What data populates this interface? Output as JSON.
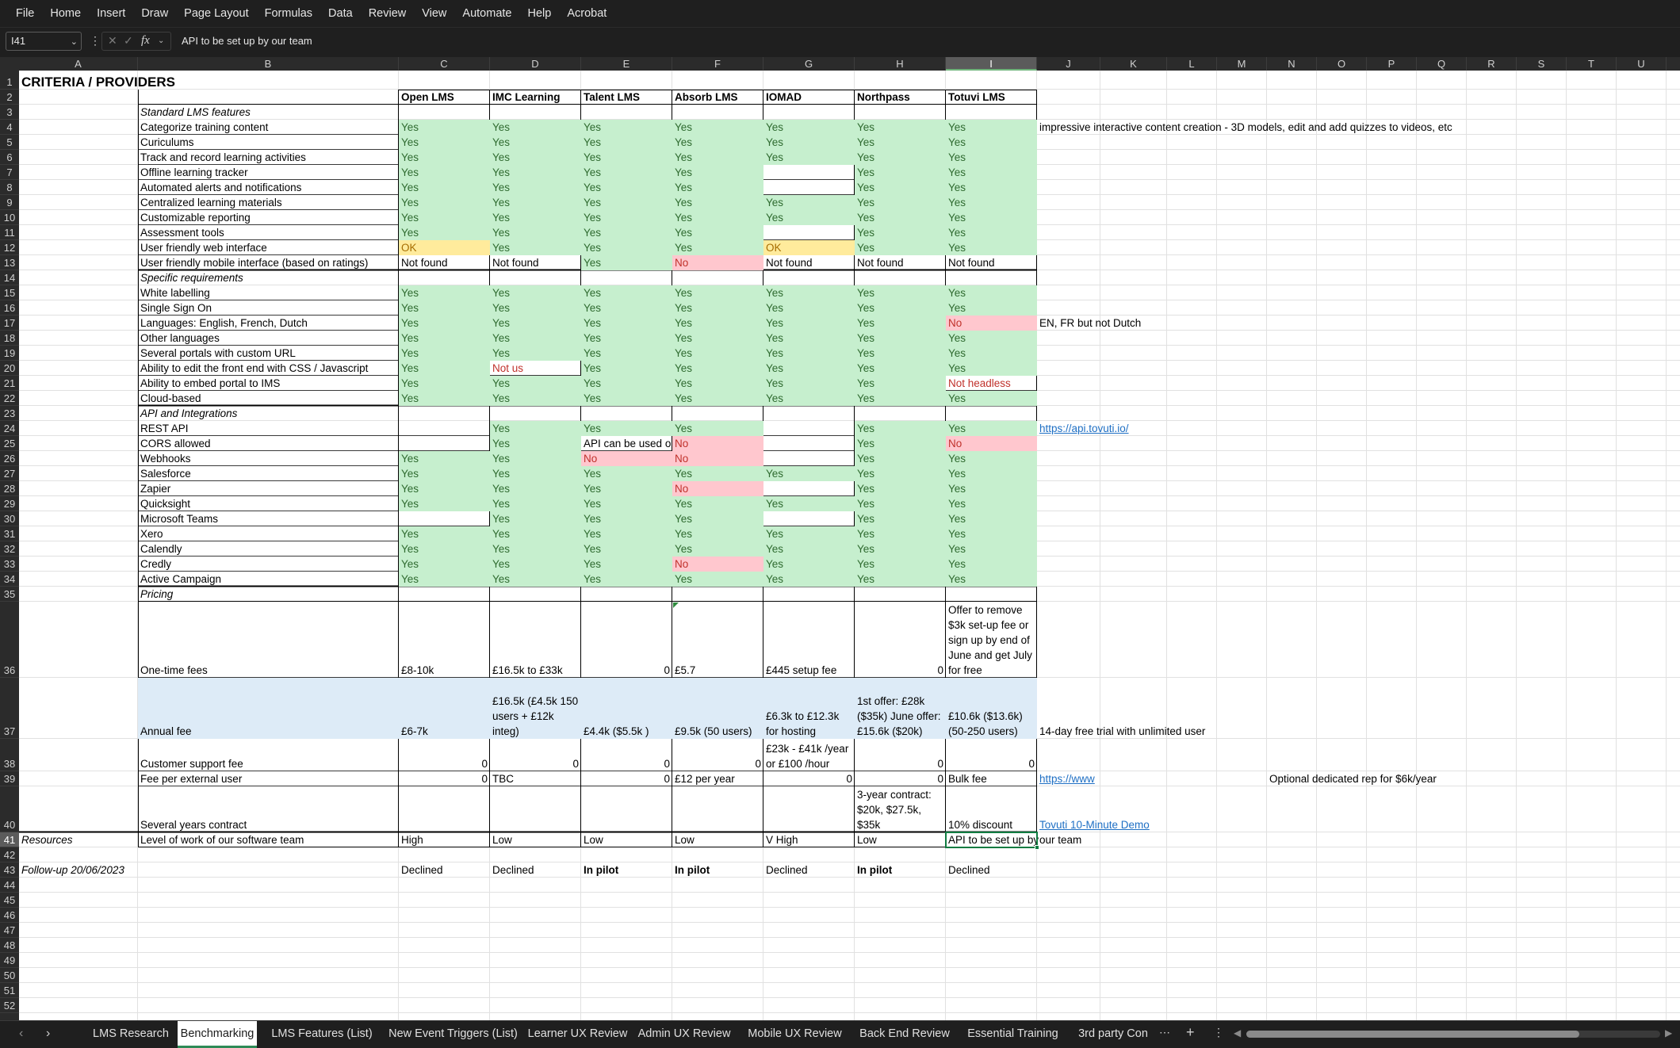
{
  "menu": [
    "File",
    "Home",
    "Insert",
    "Draw",
    "Page Layout",
    "Formulas",
    "Data",
    "Review",
    "View",
    "Automate",
    "Help",
    "Acrobat"
  ],
  "formula_bar": {
    "name_box": "I41",
    "fx": "fx",
    "content": "API to be set up by our team"
  },
  "columns": [
    "A",
    "B",
    "C",
    "D",
    "E",
    "F",
    "G",
    "H",
    "I",
    "J",
    "K",
    "L",
    "M",
    "N",
    "O",
    "P",
    "Q",
    "R",
    "S",
    "T",
    "U"
  ],
  "selected_column": "I",
  "selected_row": 41,
  "colors": {
    "green_fill": "#c6efce",
    "red_fill": "#ffc7ce",
    "amber_fill": "#ffeb9c",
    "blue_fill": "#ddebf7",
    "selection": "#107c41"
  },
  "cells": [
    {
      "r": 1,
      "c": "A",
      "v": "CRITERIA / PROVIDERS",
      "s": "title"
    },
    {
      "r": 2,
      "c": "C",
      "v": "Open LMS",
      "s": "bold"
    },
    {
      "r": 2,
      "c": "D",
      "v": "IMC Learning",
      "s": "bold"
    },
    {
      "r": 2,
      "c": "E",
      "v": "Talent LMS",
      "s": "bold"
    },
    {
      "r": 2,
      "c": "F",
      "v": "Absorb LMS",
      "s": "bold"
    },
    {
      "r": 2,
      "c": "G",
      "v": "IOMAD",
      "s": "bold"
    },
    {
      "r": 2,
      "c": "H",
      "v": "Northpass",
      "s": "bold"
    },
    {
      "r": 2,
      "c": "I",
      "v": "Totuvi LMS",
      "s": "bold"
    },
    {
      "r": 3,
      "c": "B",
      "v": "Standard LMS features",
      "s": "italic"
    },
    {
      "r": 4,
      "c": "B",
      "v": "Categorize training content"
    },
    {
      "r": 4,
      "c": "J",
      "v": "impressive interactive content creation - 3D models, edit and add quizzes to videos, etc"
    },
    {
      "r": 5,
      "c": "B",
      "v": "Curiculums"
    },
    {
      "r": 6,
      "c": "B",
      "v": "Track and record learning activities"
    },
    {
      "r": 7,
      "c": "B",
      "v": "Offline learning tracker"
    },
    {
      "r": 8,
      "c": "B",
      "v": "Automated alerts and notifications"
    },
    {
      "r": 9,
      "c": "B",
      "v": "Centralized learning materials"
    },
    {
      "r": 10,
      "c": "B",
      "v": "Customizable reporting"
    },
    {
      "r": 11,
      "c": "B",
      "v": "Assessment tools"
    },
    {
      "r": 12,
      "c": "B",
      "v": "User friendly web interface"
    },
    {
      "r": 13,
      "c": "B",
      "v": "User friendly mobile interface (based on ratings)"
    },
    {
      "r": 13,
      "c": "C",
      "v": "Not found"
    },
    {
      "r": 13,
      "c": "D",
      "v": "Not found"
    },
    {
      "r": 13,
      "c": "G",
      "v": "Not found"
    },
    {
      "r": 13,
      "c": "H",
      "v": "Not found"
    },
    {
      "r": 13,
      "c": "I",
      "v": "Not found"
    },
    {
      "r": 14,
      "c": "B",
      "v": "Specific requirements",
      "s": "italic"
    },
    {
      "r": 15,
      "c": "B",
      "v": "White labelling"
    },
    {
      "r": 16,
      "c": "B",
      "v": "Single Sign On"
    },
    {
      "r": 17,
      "c": "B",
      "v": "Languages: English, French, Dutch"
    },
    {
      "r": 17,
      "c": "J",
      "v": "EN, FR but not Dutch"
    },
    {
      "r": 18,
      "c": "B",
      "v": "Other languages"
    },
    {
      "r": 19,
      "c": "B",
      "v": "Several portals with custom URL"
    },
    {
      "r": 20,
      "c": "B",
      "v": "Ability to edit the front end with CSS / Javascript"
    },
    {
      "r": 21,
      "c": "B",
      "v": "Ability to embed portal to IMS"
    },
    {
      "r": 22,
      "c": "B",
      "v": "Cloud-based"
    },
    {
      "r": 23,
      "c": "B",
      "v": "API and Integrations",
      "s": "italic"
    },
    {
      "r": 24,
      "c": "B",
      "v": "REST API"
    },
    {
      "r": 24,
      "c": "J",
      "v": "https://api.tovuti.io/",
      "s": "link"
    },
    {
      "r": 25,
      "c": "B",
      "v": "CORS allowed"
    },
    {
      "r": 25,
      "c": "E",
      "v": "API can be used only server side",
      "s": "clip"
    },
    {
      "r": 26,
      "c": "B",
      "v": "Webhooks"
    },
    {
      "r": 27,
      "c": "B",
      "v": "Salesforce"
    },
    {
      "r": 28,
      "c": "B",
      "v": "Zapier"
    },
    {
      "r": 29,
      "c": "B",
      "v": "Quicksight"
    },
    {
      "r": 30,
      "c": "B",
      "v": "Microsoft Teams"
    },
    {
      "r": 31,
      "c": "B",
      "v": "Xero"
    },
    {
      "r": 32,
      "c": "B",
      "v": "Calendly"
    },
    {
      "r": 33,
      "c": "B",
      "v": "Credly"
    },
    {
      "r": 34,
      "c": "B",
      "v": "Active Campaign"
    },
    {
      "r": 35,
      "c": "B",
      "v": "Pricing",
      "s": "italic"
    },
    {
      "r": 36,
      "c": "B",
      "v": "One-time fees"
    },
    {
      "r": 36,
      "c": "C",
      "v": "£8-10k"
    },
    {
      "r": 36,
      "c": "D",
      "v": "£16.5k to £33k"
    },
    {
      "r": 36,
      "c": "E",
      "v": "0",
      "s": "right"
    },
    {
      "r": 36,
      "c": "F",
      "v": "£5.7"
    },
    {
      "r": 36,
      "c": "G",
      "v": "£445 setup fee"
    },
    {
      "r": 36,
      "c": "H",
      "v": "0",
      "s": "right"
    },
    {
      "r": 36,
      "c": "I",
      "v": "Offer to remove $3k set-up fee or sign up by end of June and get July for free",
      "s": "wrap"
    },
    {
      "r": 37,
      "c": "B",
      "v": "Annual fee"
    },
    {
      "r": 37,
      "c": "C",
      "v": "£6-7k"
    },
    {
      "r": 37,
      "c": "D",
      "v": "£16.5k (£4.5k 150 users + £12k integ)",
      "s": "wrap"
    },
    {
      "r": 37,
      "c": "E",
      "v": "£4.4k ($5.5k )"
    },
    {
      "r": 37,
      "c": "F",
      "v": "£9.5k (50 users)"
    },
    {
      "r": 37,
      "c": "G",
      "v": "£6.3k to £12.3k for hosting",
      "s": "wrap"
    },
    {
      "r": 37,
      "c": "H",
      "v": "1st offer: £28k ($35k) June offer: £15.6k ($20k)",
      "s": "wrap"
    },
    {
      "r": 37,
      "c": "I",
      "v": "£10.6k ($13.6k) (50-250 users)",
      "s": "wrap"
    },
    {
      "r": 37,
      "c": "J",
      "v": "14-day free trial with unlimited user"
    },
    {
      "r": 38,
      "c": "B",
      "v": "Customer support fee"
    },
    {
      "r": 38,
      "c": "C",
      "v": "0",
      "s": "right"
    },
    {
      "r": 38,
      "c": "D",
      "v": "0",
      "s": "right"
    },
    {
      "r": 38,
      "c": "E",
      "v": "0",
      "s": "right"
    },
    {
      "r": 38,
      "c": "F",
      "v": "0",
      "s": "right"
    },
    {
      "r": 38,
      "c": "G",
      "v": "£23k - £41k /year or £100 /hour",
      "s": "wrap"
    },
    {
      "r": 38,
      "c": "H",
      "v": "0",
      "s": "right"
    },
    {
      "r": 38,
      "c": "I",
      "v": "0",
      "s": "right"
    },
    {
      "r": 39,
      "c": "B",
      "v": "Fee per external user"
    },
    {
      "r": 39,
      "c": "C",
      "v": "0",
      "s": "right"
    },
    {
      "r": 39,
      "c": "D",
      "v": "TBC"
    },
    {
      "r": 39,
      "c": "E",
      "v": "0",
      "s": "right"
    },
    {
      "r": 39,
      "c": "F",
      "v": "£12 per year"
    },
    {
      "r": 39,
      "c": "G",
      "v": "0",
      "s": "right"
    },
    {
      "r": 39,
      "c": "H",
      "v": "0",
      "s": "right"
    },
    {
      "r": 39,
      "c": "I",
      "v": "Bulk fee"
    },
    {
      "r": 39,
      "c": "J",
      "v": "https://www",
      "s": "link"
    },
    {
      "r": 39,
      "c": "N",
      "v": "Optional dedicated rep for $6k/year"
    },
    {
      "r": 40,
      "c": "B",
      "v": "Several years contract"
    },
    {
      "r": 40,
      "c": "H",
      "v": "3-year contract: $20k, $27.5k, $35k",
      "s": "wrap"
    },
    {
      "r": 40,
      "c": "I",
      "v": "10% discount"
    },
    {
      "r": 40,
      "c": "J",
      "v": "Tovuti 10-Minute Demo",
      "s": "link"
    },
    {
      "r": 41,
      "c": "A",
      "v": "Resources",
      "s": "italic"
    },
    {
      "r": 41,
      "c": "B",
      "v": "Level of work of our software team"
    },
    {
      "r": 41,
      "c": "C",
      "v": "High"
    },
    {
      "r": 41,
      "c": "D",
      "v": "Low"
    },
    {
      "r": 41,
      "c": "E",
      "v": "Low"
    },
    {
      "r": 41,
      "c": "F",
      "v": "Low"
    },
    {
      "r": 41,
      "c": "G",
      "v": "V High"
    },
    {
      "r": 41,
      "c": "H",
      "v": "Low"
    },
    {
      "r": 41,
      "c": "I",
      "v": "API to be set up by"
    },
    {
      "r": 41,
      "c": "J",
      "v": "our team"
    },
    {
      "r": 43,
      "c": "A",
      "v": "Follow-up 20/06/2023",
      "s": "italic"
    },
    {
      "r": 43,
      "c": "C",
      "v": "Declined"
    },
    {
      "r": 43,
      "c": "D",
      "v": "Declined"
    },
    {
      "r": 43,
      "c": "E",
      "v": "In pilot",
      "s": "bold"
    },
    {
      "r": 43,
      "c": "F",
      "v": "In pilot",
      "s": "bold"
    },
    {
      "r": 43,
      "c": "G",
      "v": "Declined"
    },
    {
      "r": 43,
      "c": "H",
      "v": "In pilot",
      "s": "bold"
    },
    {
      "r": 43,
      "c": "I",
      "v": "Declined"
    }
  ],
  "yes_no_matrix": {
    "columns": [
      "C",
      "D",
      "E",
      "F",
      "G",
      "H",
      "I"
    ],
    "rows": {
      "4": [
        "Yes",
        "Yes",
        "Yes",
        "Yes",
        "Yes",
        "Yes",
        "Yes"
      ],
      "5": [
        "Yes",
        "Yes",
        "Yes",
        "Yes",
        "Yes",
        "Yes",
        "Yes"
      ],
      "6": [
        "Yes",
        "Yes",
        "Yes",
        "Yes",
        "Yes",
        "Yes",
        "Yes"
      ],
      "7": [
        "Yes",
        "Yes",
        "Yes",
        "Yes",
        "",
        "Yes",
        "Yes"
      ],
      "8": [
        "Yes",
        "Yes",
        "Yes",
        "Yes",
        "",
        "Yes",
        "Yes"
      ],
      "9": [
        "Yes",
        "Yes",
        "Yes",
        "Yes",
        "Yes",
        "Yes",
        "Yes"
      ],
      "10": [
        "Yes",
        "Yes",
        "Yes",
        "Yes",
        "Yes",
        "Yes",
        "Yes"
      ],
      "11": [
        "Yes",
        "Yes",
        "Yes",
        "Yes",
        "",
        "Yes",
        "Yes"
      ],
      "12": [
        "OK",
        "Yes",
        "Yes",
        "Yes",
        "OK",
        "Yes",
        "Yes"
      ],
      "13": [
        "",
        "",
        "Yes",
        "No",
        "",
        "",
        ""
      ],
      "15": [
        "Yes",
        "Yes",
        "Yes",
        "Yes",
        "Yes",
        "Yes",
        "Yes"
      ],
      "16": [
        "Yes",
        "Yes",
        "Yes",
        "Yes",
        "Yes",
        "Yes",
        "Yes"
      ],
      "17": [
        "Yes",
        "Yes",
        "Yes",
        "Yes",
        "Yes",
        "Yes",
        "No"
      ],
      "18": [
        "Yes",
        "Yes",
        "Yes",
        "Yes",
        "Yes",
        "Yes",
        "Yes"
      ],
      "19": [
        "Yes",
        "Yes",
        "Yes",
        "Yes",
        "Yes",
        "Yes",
        "Yes"
      ],
      "20": [
        "Yes",
        "Not us",
        "Yes",
        "Yes",
        "Yes",
        "Yes",
        "Yes"
      ],
      "21": [
        "Yes",
        "Yes",
        "Yes",
        "Yes",
        "Yes",
        "Yes",
        "Not headless"
      ],
      "22": [
        "Yes",
        "Yes",
        "Yes",
        "Yes",
        "Yes",
        "Yes",
        "Yes"
      ],
      "24": [
        "",
        "Yes",
        "Yes",
        "Yes",
        "",
        "Yes",
        "Yes"
      ],
      "25": [
        "",
        "Yes",
        "",
        "No",
        "",
        "Yes",
        "No"
      ],
      "26": [
        "Yes",
        "Yes",
        "No",
        "No",
        "",
        "Yes",
        "Yes"
      ],
      "27": [
        "Yes",
        "Yes",
        "Yes",
        "Yes",
        "Yes",
        "Yes",
        "Yes"
      ],
      "28": [
        "Yes",
        "Yes",
        "Yes",
        "No",
        "",
        "Yes",
        "Yes"
      ],
      "29": [
        "Yes",
        "Yes",
        "Yes",
        "Yes",
        "Yes",
        "Yes",
        "Yes"
      ],
      "30": [
        "",
        "Yes",
        "Yes",
        "Yes",
        "",
        "Yes",
        "Yes"
      ],
      "31": [
        "Yes",
        "Yes",
        "Yes",
        "Yes",
        "Yes",
        "Yes",
        "Yes"
      ],
      "32": [
        "Yes",
        "Yes",
        "Yes",
        "Yes",
        "Yes",
        "Yes",
        "Yes"
      ],
      "33": [
        "Yes",
        "Yes",
        "Yes",
        "No",
        "Yes",
        "Yes",
        "Yes"
      ],
      "34": [
        "Yes",
        "Yes",
        "Yes",
        "Yes",
        "Yes",
        "Yes",
        "Yes"
      ]
    }
  },
  "sheet_tabs": [
    "LMS Research",
    "Benchmarking",
    "LMS Features (List)",
    "New Event Triggers (List)",
    "Learner UX Review",
    "Admin UX Review",
    "Mobile UX Review",
    "Back End Review",
    "Essential Training",
    "3rd party Con"
  ],
  "active_tab": "Benchmarking"
}
